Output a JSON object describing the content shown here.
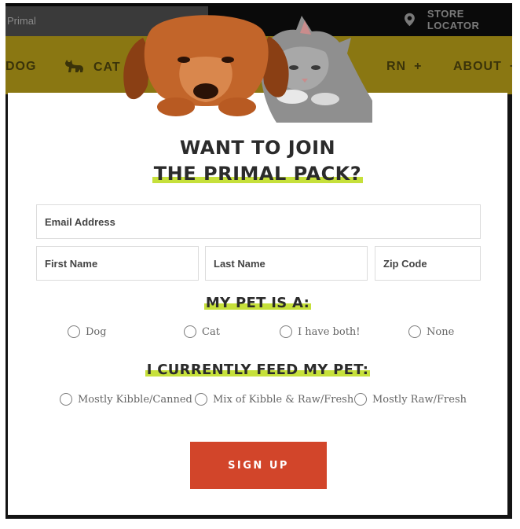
{
  "site": {
    "search_text": "Primal",
    "store_locator": "STORE LOCATOR",
    "nav": [
      {
        "label": "DOG"
      },
      {
        "label": "CAT"
      },
      {
        "label": "RN"
      },
      {
        "label": "ABOUT"
      }
    ],
    "nav_plus": "+"
  },
  "modal": {
    "title_line1": "WANT TO JOIN",
    "title_line2": "THE PRIMAL PACK?",
    "fields": {
      "email_placeholder": "Email Address",
      "first_name_placeholder": "First Name",
      "last_name_placeholder": "Last Name",
      "zip_placeholder": "Zip Code"
    },
    "pet_heading": "MY PET IS A:",
    "pet_options": [
      "Dog",
      "Cat",
      "I have both!",
      "None"
    ],
    "feed_heading": "I CURRENTLY FEED MY PET:",
    "feed_options": [
      "Mostly Kibble/Canned",
      "Mix of Kibble & Raw/Fresh",
      "Mostly Raw/Fresh"
    ],
    "signup_label": "SIGN UP"
  },
  "colors": {
    "accent_green": "#c6e03b",
    "signup_red": "#d2452a",
    "nav_olive": "#8a7712"
  },
  "icons": [
    "map-pin-icon",
    "cat-silhouette-icon",
    "dog-and-cat-image"
  ]
}
